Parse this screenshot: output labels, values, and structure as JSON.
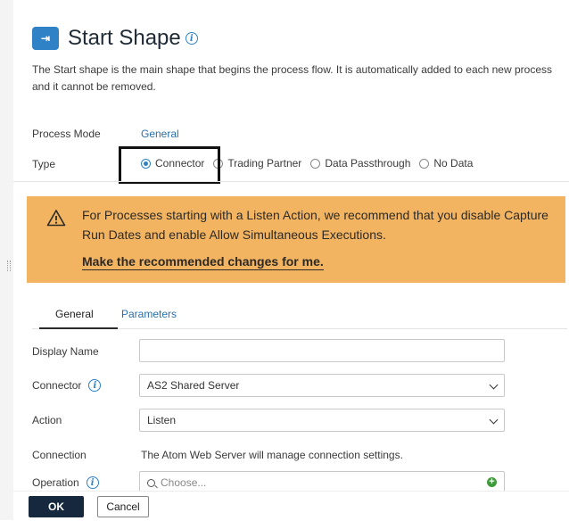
{
  "header": {
    "logo_glyph": "⇥",
    "title": "Start Shape",
    "info_glyph": "i"
  },
  "description": "The Start shape is the main shape that begins the process flow. It is automatically added to each new process and it cannot be removed.",
  "process_mode": {
    "label": "Process Mode",
    "value": "General"
  },
  "type": {
    "label": "Type",
    "options": [
      "Connector",
      "Trading Partner",
      "Data Passthrough",
      "No Data"
    ],
    "selected": "Connector"
  },
  "warning": {
    "text": "For Processes starting with a Listen Action, we recommend that you disable Capture Run Dates and enable Allow Simultaneous Executions.",
    "link": "Make the recommended changes for me."
  },
  "tabs": {
    "general": "General",
    "parameters": "Parameters"
  },
  "form": {
    "display_name": {
      "label": "Display Name",
      "value": ""
    },
    "connector": {
      "label": "Connector",
      "value": "AS2 Shared Server"
    },
    "action": {
      "label": "Action",
      "value": "Listen"
    },
    "connection": {
      "label": "Connection",
      "text": "The Atom Web Server will manage connection settings."
    },
    "operation": {
      "label": "Operation",
      "placeholder": "Choose..."
    }
  },
  "buttons": {
    "ok": "OK",
    "cancel": "Cancel"
  },
  "colors": {
    "accent": "#2f82c6",
    "warning_bg": "#f3b461",
    "ok_bg": "#16283d"
  }
}
